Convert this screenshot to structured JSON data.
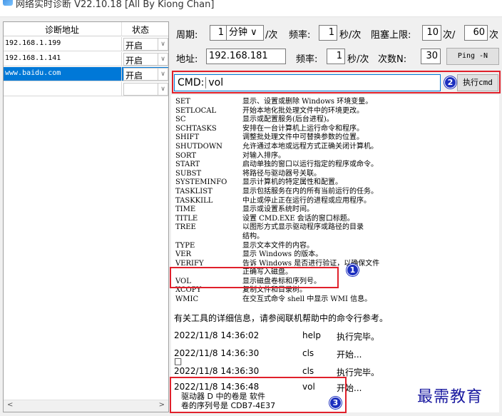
{
  "window": {
    "title": "网络实时诊断 V22.10.18 [All By Kiong Chan]"
  },
  "table": {
    "header_address": "诊断地址",
    "header_state": "状态",
    "rows": [
      {
        "address": "192.168.1.199",
        "state": "开启"
      },
      {
        "address": "192.168.1.141",
        "state": "开启"
      },
      {
        "address": "www.baidu.com",
        "state": "开启"
      },
      {
        "address": "",
        "state": ""
      }
    ],
    "scroll_left": "<",
    "scroll_right": ">"
  },
  "controls": {
    "period_label": "周期:",
    "period_value": "1",
    "period_unit": "分钟 ∨",
    "per_label": "/次",
    "freq_label": "频率:",
    "freq_value": "1",
    "freq_unit": "秒/次",
    "block_label": "阻塞上限:",
    "block_value": "10",
    "block_unit": "次/",
    "block_value2": "60",
    "block_unit2": "次",
    "addr_label": "地址:",
    "addr_value": "192.168.181",
    "freq2_label": "频率:",
    "freq2_value": "1",
    "freq2_unit": "秒/次",
    "count_label": "次数N:",
    "count_value": "30",
    "ping_button": "Ping -N",
    "cmd_label": "CMD:",
    "cmd_value": "vol",
    "exec_button": "执行cmd",
    "badge2": "2"
  },
  "output": {
    "commands": [
      {
        "name": "SET",
        "desc": "显示、设置或删除 Windows 环境变量。"
      },
      {
        "name": "SETLOCAL",
        "desc": "开始本地化批处理文件中的环境更改。"
      },
      {
        "name": "SC",
        "desc": "显示或配置服务(后台进程)。"
      },
      {
        "name": "SCHTASKS",
        "desc": "安排在一台计算机上运行命令和程序。"
      },
      {
        "name": "SHIFT",
        "desc": "调整批处理文件中可替换参数的位置。"
      },
      {
        "name": "SHUTDOWN",
        "desc": "允许通过本地或远程方式正确关闭计算机。"
      },
      {
        "name": "SORT",
        "desc": "对输入排序。"
      },
      {
        "name": "START",
        "desc": "启动单独的窗口以运行指定的程序或命令。"
      },
      {
        "name": "SUBST",
        "desc": "将路径与驱动器号关联。"
      },
      {
        "name": "SYSTEMINFO",
        "desc": "显示计算机的特定属性和配置。"
      },
      {
        "name": "TASKLIST",
        "desc": "显示包括服务在内的所有当前运行的任务。"
      },
      {
        "name": "TASKKILL",
        "desc": "中止或停止正在运行的进程或应用程序。"
      },
      {
        "name": "TIME",
        "desc": "显示或设置系统时间。"
      },
      {
        "name": "TITLE",
        "desc": "设置 CMD.EXE 会话的窗口标题。"
      },
      {
        "name": "TREE",
        "desc": "以图形方式显示驱动程序或路径的目录"
      },
      {
        "name": "",
        "desc": "结构。"
      },
      {
        "name": "TYPE",
        "desc": "显示文本文件的内容。"
      },
      {
        "name": "VER",
        "desc": "显示 Windows 的版本。"
      },
      {
        "name": "VERIFY",
        "desc": "告诉 Windows 是否进行验证，以确保文件"
      },
      {
        "name": "",
        "desc": "正确写入磁盘。"
      },
      {
        "name": "VOL",
        "desc": "显示磁盘卷标和序列号。"
      },
      {
        "name": "XCOPY",
        "desc": "复制文件和目录树。"
      },
      {
        "name": "WMIC",
        "desc": "在交互式命令 shell 中显示 WMI 信息。"
      }
    ],
    "help_tail": "有关工具的详细信息，请参阅联机帮助中的命令行参考。",
    "logs": [
      {
        "time": "2022/11/8 14:36:02",
        "cmd": "help",
        "status": "执行完毕。"
      },
      {
        "time": "2022/11/8 14:36:30",
        "cmd": "cls",
        "status": "开始..."
      },
      {
        "time": "□",
        "cmd": "",
        "status": ""
      },
      {
        "time": "2022/11/8 14:36:30",
        "cmd": "cls",
        "status": "执行完毕。"
      },
      {
        "time": "2022/11/8 14:36:48",
        "cmd": "vol",
        "status": "开始..."
      }
    ],
    "vol_line1": "驱动器 D 中的卷是 软件",
    "vol_line2": "卷的序列号是 CDB7-4E37",
    "badge1": "1",
    "badge3": "3"
  },
  "watermark": "最需教育"
}
